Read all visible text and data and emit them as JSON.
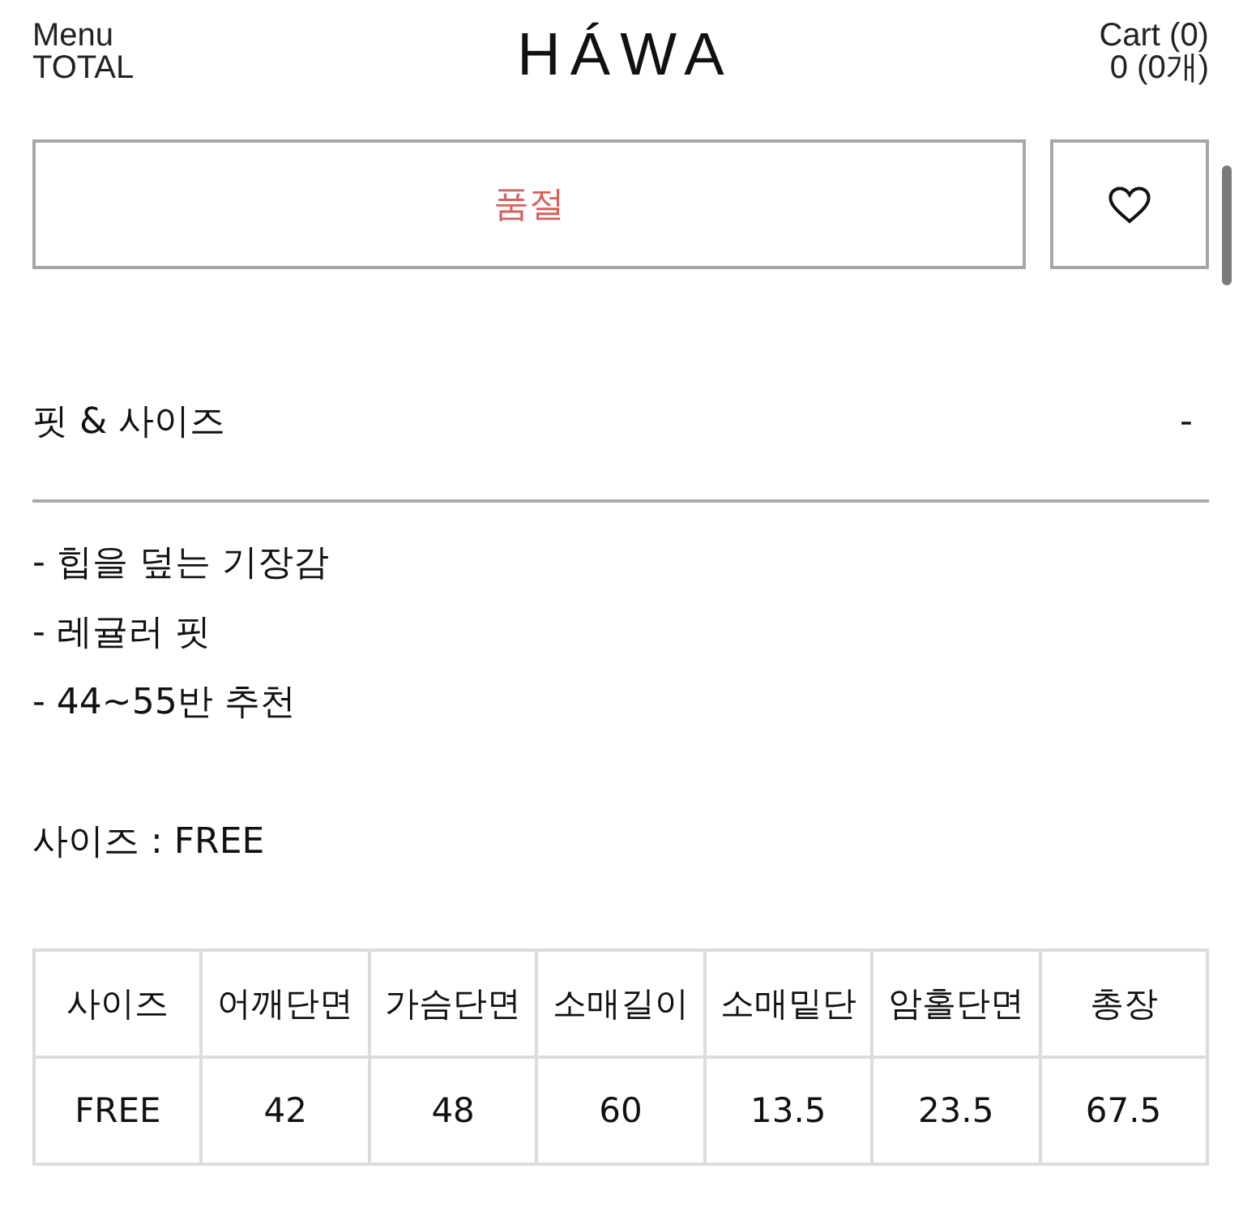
{
  "header": {
    "menu": "Menu",
    "logo": "HÁWA",
    "cart": "Cart (0)"
  },
  "total_bar": {
    "label": "TOTAL",
    "value": "0 (0개)"
  },
  "actions": {
    "buy_button": {
      "label": "품절"
    },
    "wishlist": {
      "selected": false
    }
  },
  "section": {
    "title": "핏 & 사이즈",
    "toggle": "-"
  },
  "details": [
    "- 힙을 덮는 기장감",
    "- 레귤러 핏",
    "- 44~55반 추천"
  ],
  "size_note": "사이즈 : FREE",
  "size_table": {
    "columns": [
      "사이즈",
      "어깨단면",
      "가슴단면",
      "소매길이",
      "소매밑단",
      "암홀단면",
      "총장"
    ],
    "rows": [
      [
        "FREE",
        "42",
        "48",
        "60",
        "13.5",
        "23.5",
        "67.5"
      ]
    ]
  }
}
